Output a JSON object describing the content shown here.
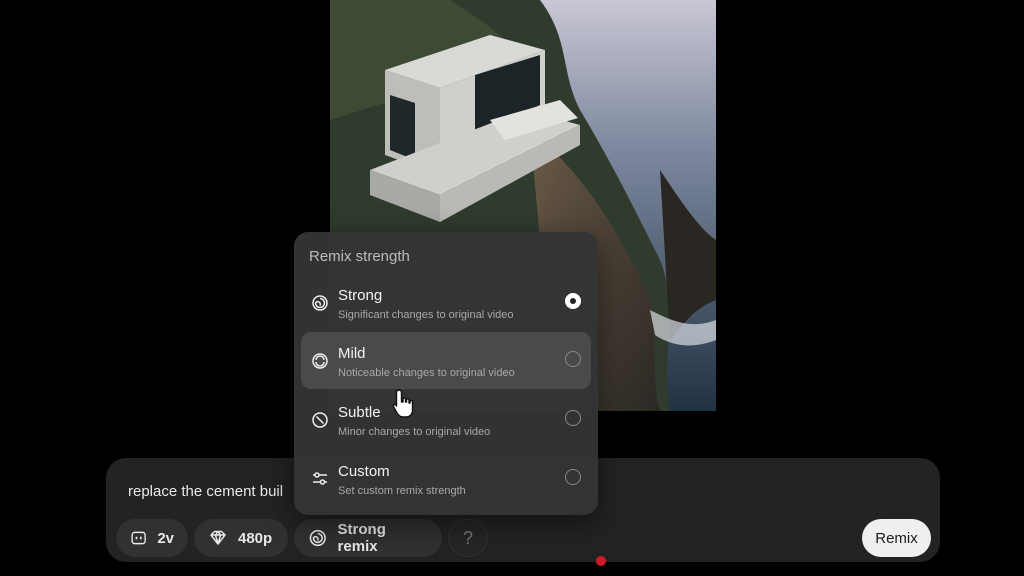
{
  "prompt": {
    "text": "replace the cement buil"
  },
  "toolbar": {
    "duration": "2v",
    "resolution": "480p",
    "remix_mode": "Strong remix",
    "help": "?",
    "submit": "Remix"
  },
  "remix_menu": {
    "title": "Remix strength",
    "options": [
      {
        "label": "Strong",
        "description": "Significant changes to original video",
        "icon": "spiral-icon",
        "selected": true
      },
      {
        "label": "Mild",
        "description": "Noticeable changes to original video",
        "icon": "mild-spiral-icon",
        "selected": false
      },
      {
        "label": "Subtle",
        "description": "Minor changes to original video",
        "icon": "subtle-circle-icon",
        "selected": false
      },
      {
        "label": "Custom",
        "description": "Set custom remix strength",
        "icon": "sliders-icon",
        "selected": false
      }
    ]
  }
}
